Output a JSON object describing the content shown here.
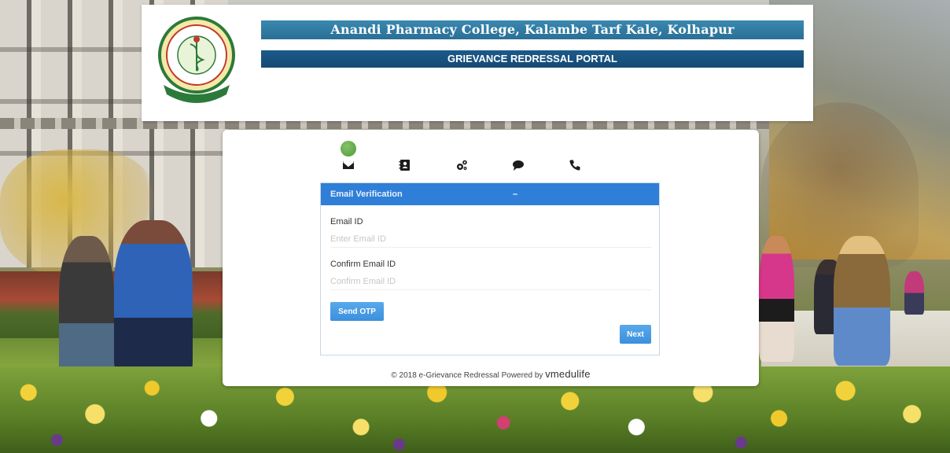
{
  "header": {
    "college_name": "Anandi Pharmacy College, Kalambe Tarf Kale, Kolhapur",
    "portal_name": "GRIEVANCE REDRESSAL PORTAL",
    "logo_icon": "college-emblem-icon"
  },
  "steps": [
    {
      "icon": "envelope-icon",
      "active": true
    },
    {
      "icon": "contact-card-icon",
      "active": false
    },
    {
      "icon": "gears-icon",
      "active": false
    },
    {
      "icon": "speech-bubble-icon",
      "active": false
    },
    {
      "icon": "phone-icon",
      "active": false
    }
  ],
  "panel": {
    "title": "Email Verification",
    "collapse_symbol": "–",
    "email_label": "Email ID",
    "email_placeholder": "Enter Email ID",
    "confirm_label": "Confirm Email ID",
    "confirm_placeholder": "Confirm Email ID",
    "send_otp_label": "Send OTP",
    "next_label": "Next"
  },
  "footer": {
    "text": "© 2018 e-Grievance Redressal Powered by ",
    "brand": "vmedulife"
  },
  "colors": {
    "title_bar": "#2a6f96",
    "subtitle_bar": "#154a74",
    "panel_header": "#2f7fd8",
    "button": "#3b8fdc"
  }
}
